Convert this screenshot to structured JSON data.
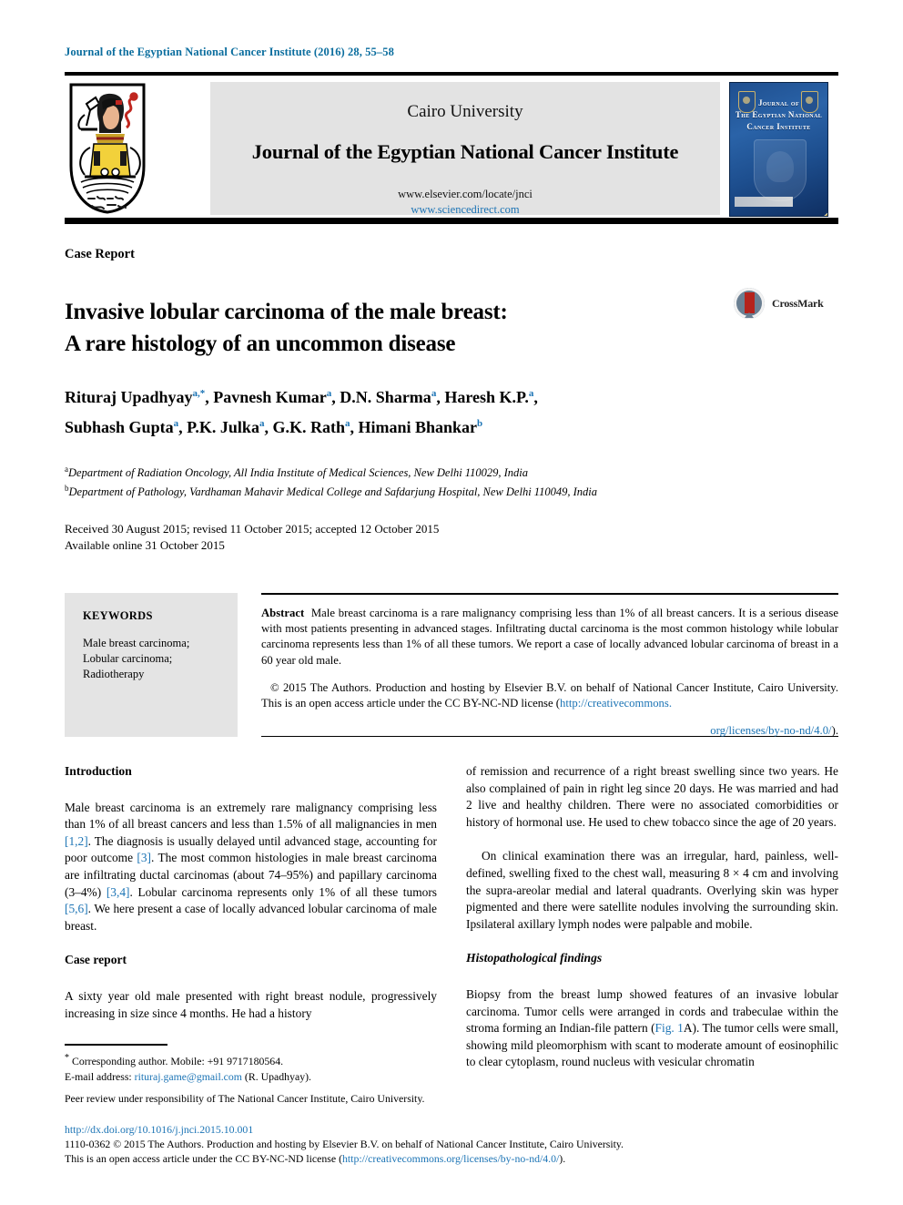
{
  "running_head": "Journal of the Egyptian National Cancer Institute (2016) 28, 55–58",
  "masthead": {
    "university": "Cairo University",
    "journal": "Journal of the Egyptian National Cancer Institute",
    "url_elsevier": "www.elsevier.com/locate/jnci",
    "url_sciencedirect": "www.sciencedirect.com",
    "cover_title_line1": "Journal of",
    "cover_title_line2": "The Egyptian National",
    "cover_title_line3": "Cancer Institute",
    "crest_alt": "cairo-university-crest"
  },
  "article": {
    "type": "Case Report",
    "title_line1": "Invasive lobular carcinoma of the male breast:",
    "title_line2": "A rare histology of an uncommon disease",
    "crossmark_label": "CrossMark"
  },
  "authors": {
    "line1": [
      {
        "name": "Rituraj Upadhyay",
        "sup": "a,*"
      },
      {
        "name": "Pavnesh Kumar",
        "sup": "a"
      },
      {
        "name": "D.N. Sharma",
        "sup": "a"
      },
      {
        "name": "Haresh K.P.",
        "sup": "a"
      }
    ],
    "line2": [
      {
        "name": "Subhash Gupta",
        "sup": "a"
      },
      {
        "name": "P.K. Julka",
        "sup": "a"
      },
      {
        "name": "G.K. Rath",
        "sup": "a"
      },
      {
        "name": "Himani Bhankar",
        "sup": "b"
      }
    ]
  },
  "affiliations": [
    {
      "mark": "a",
      "text": "Department of Radiation Oncology, All India Institute of Medical Sciences, New Delhi 110029, India"
    },
    {
      "mark": "b",
      "text": "Department of Pathology, Vardhaman Mahavir Medical College and Safdarjung Hospital, New Delhi 110049, India"
    }
  ],
  "dates": {
    "line1": "Received 30 August 2015; revised 11 October 2015; accepted 12 October 2015",
    "line2": "Available online 31 October 2015"
  },
  "keywords": {
    "heading": "KEYWORDS",
    "items": "Male breast carcinoma;\nLobular carcinoma;\nRadiotherapy"
  },
  "abstract": {
    "label": "Abstract",
    "text": "Male breast carcinoma is a rare malignancy comprising less than 1% of all breast cancers. It is a serious disease with most patients presenting in advanced stages. Infiltrating ductal carcinoma is the most common histology while lobular carcinoma represents less than 1% of all these tumors. We report a case of locally advanced lobular carcinoma of breast in a 60 year old male.",
    "copyright": "© 2015 The Authors. Production and hosting by Elsevier B.V. on behalf of National Cancer Institute, Cairo University.  This is an open access article under the CC BY-NC-ND license (",
    "license_link_part1": "http://creativecommons.",
    "license_link_part2": "org/licenses/by-no-nd/4.0/",
    "license_close": ")."
  },
  "body": {
    "intro_heading": "Introduction",
    "intro_p1_a": "Male breast carcinoma is an extremely rare malignancy comprising less than 1% of all breast cancers and less than 1.5% of all malignancies in men ",
    "intro_ref1": "[1,2]",
    "intro_p1_b": ". The diagnosis is usually delayed until advanced stage, accounting for poor outcome ",
    "intro_ref2": "[3]",
    "intro_p1_c": ". The most common histologies in male breast carcinoma are infiltrating ductal carcinomas (about 74–95%) and papillary carcinoma (3–4%) ",
    "intro_ref3": "[3,4]",
    "intro_p1_d": ". Lobular carcinoma represents only 1% of all these tumors ",
    "intro_ref4": "[5,6]",
    "intro_p1_e": ". We here present a case of locally advanced lobular carcinoma of male breast.",
    "case_heading": "Case report",
    "case_p1": "A sixty year old male presented with right breast nodule, progressively increasing in size since 4 months. He had a history",
    "case_p1_cont": "of remission and recurrence of a right breast swelling since two years. He also complained of pain in right leg since 20 days. He was married and had 2 live and healthy children. There were no associated comorbidities or history of hormonal use. He used to chew tobacco since the age of 20 years.",
    "case_p2": "On clinical examination there was an irregular, hard, painless, well-defined, swelling fixed to the chest wall, measuring 8 × 4 cm and involving the supra-areolar medial and lateral quadrants. Overlying skin was hyper pigmented and there were satellite nodules involving the surrounding skin. Ipsilateral axillary lymph nodes were palpable and mobile.",
    "histo_heading": "Histopathological findings",
    "histo_p1_a": "Biopsy from the breast lump showed features of an invasive lobular carcinoma. Tumor cells were arranged in cords and trabeculae within the stroma forming an Indian-file pattern (",
    "histo_fig_ref": "Fig. 1",
    "histo_p1_b": "A). The tumor cells were small, showing mild pleomorphism with scant to moderate amount of eosinophilic to clear cytoplasm, round nucleus with vesicular chromatin"
  },
  "footnotes": {
    "corr_mark": "*",
    "corr_text": "  Corresponding author. Mobile: +91 9717180564.",
    "email_label": "E-mail address: ",
    "email": "rituraj.game@gmail.com",
    "email_suffix": " (R. Upadhyay).",
    "peer_review": "Peer review under responsibility of The National Cancer Institute, Cairo University."
  },
  "page_footer": {
    "doi": "http://dx.doi.org/10.1016/j.jnci.2015.10.001",
    "line2": "1110-0362 © 2015 The Authors. Production and hosting by Elsevier B.V. on behalf of National Cancer Institute, Cairo University.",
    "line3_a": "This is an open access article under the CC BY-NC-ND license (",
    "line3_link": "http://creativecommons.org/licenses/by-no-nd/4.0/",
    "line3_b": ")."
  },
  "colors": {
    "link": "#1c74b5",
    "runhead": "#0a6d9e",
    "keyword_panel": "#e4e4e4",
    "masthead_panel": "#e3e3e3",
    "crossmark_ribbon": "#b5231c"
  }
}
